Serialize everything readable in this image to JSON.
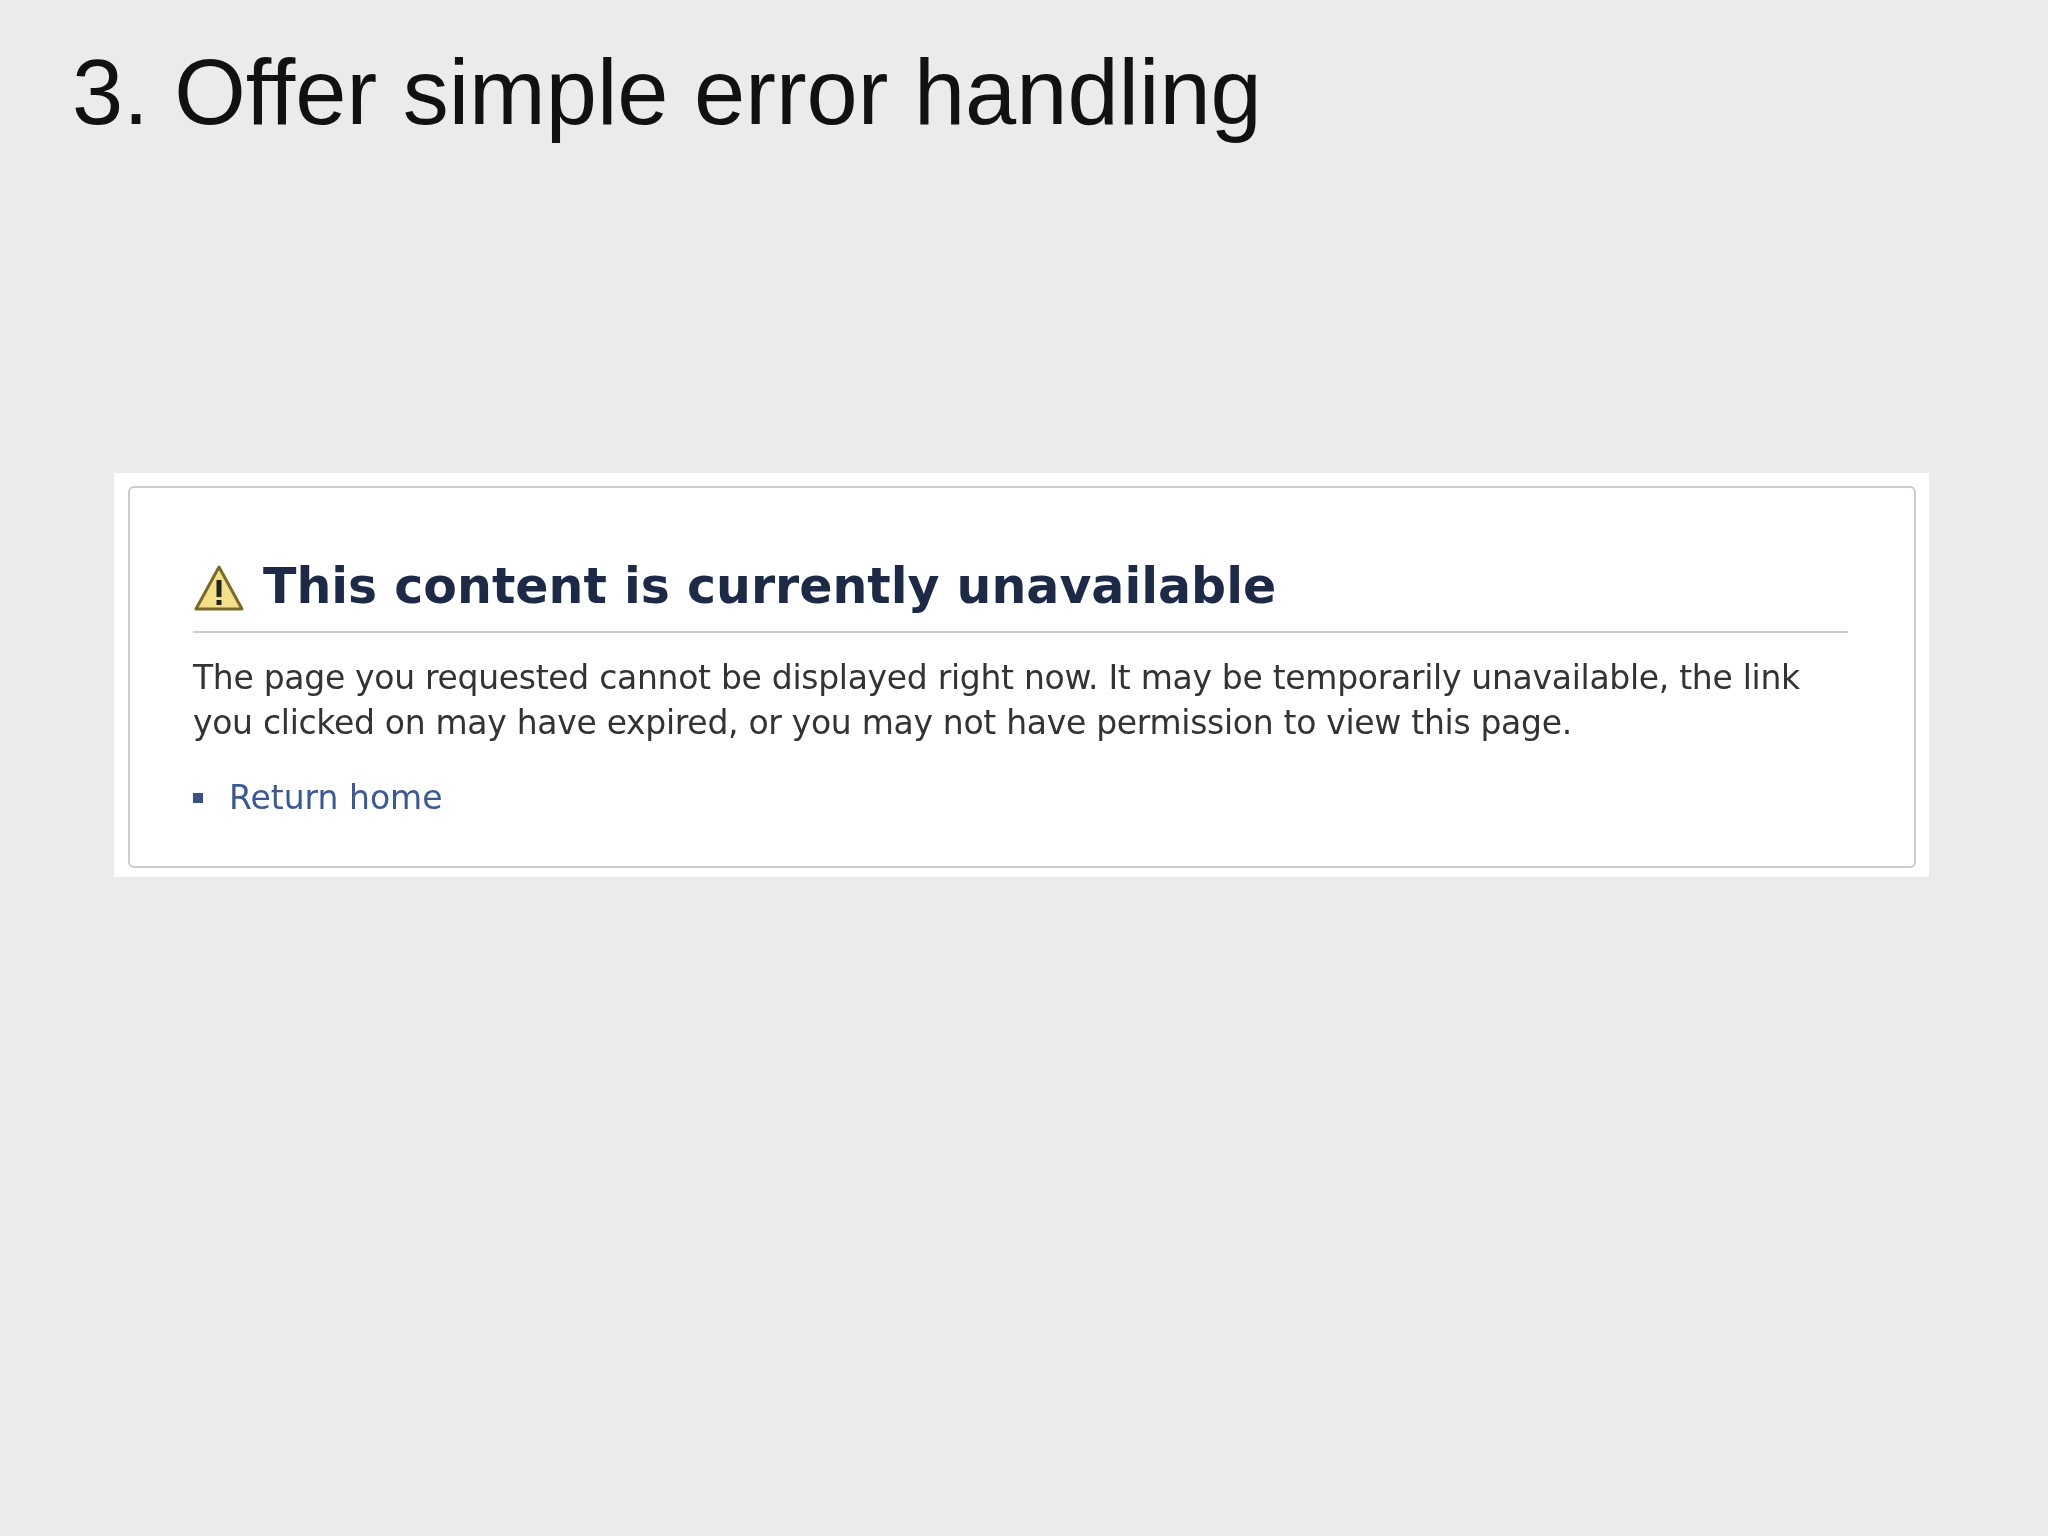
{
  "slide": {
    "title": "3. Offer simple error handling"
  },
  "error_page": {
    "heading": "This content is currently unavailable",
    "message": "The page you requested cannot be displayed right now. It may be temporarily unavailable, the link you clicked on may have expired, or you may not have permission to view this page.",
    "links": [
      {
        "text": "Return home"
      }
    ]
  }
}
